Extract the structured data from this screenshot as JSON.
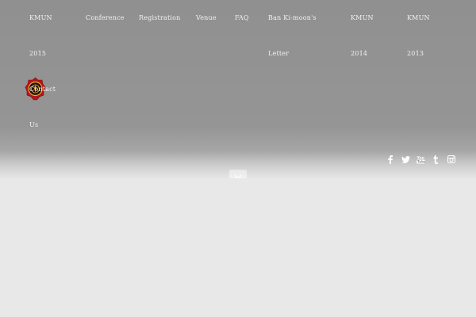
{
  "nav": {
    "kmun2015": {
      "line1": "KMUN",
      "line2": "2015"
    },
    "conference": "Conference",
    "registration": "Registration",
    "venue": "Venue",
    "faq": "FAQ",
    "letter": {
      "line1": "Ban Ki-moon's",
      "line2": "Letter"
    },
    "kmun2014": {
      "line1": "KMUN",
      "line2": "2014"
    },
    "kmun2013": {
      "line1": "KMUN",
      "line2": "2013"
    },
    "contact": {
      "line1": "Contact",
      "line2": "Us"
    }
  },
  "social": [
    "facebook-icon",
    "twitter-icon",
    "youtube-icon",
    "tumblr-icon",
    "instagram-icon"
  ],
  "colors": {
    "header_bg": "#919191",
    "nav_text": "#f2f2f2",
    "page_bg": "#e8e8e8",
    "logo_red": "#c0161b",
    "logo_gold": "#e0b43a"
  }
}
